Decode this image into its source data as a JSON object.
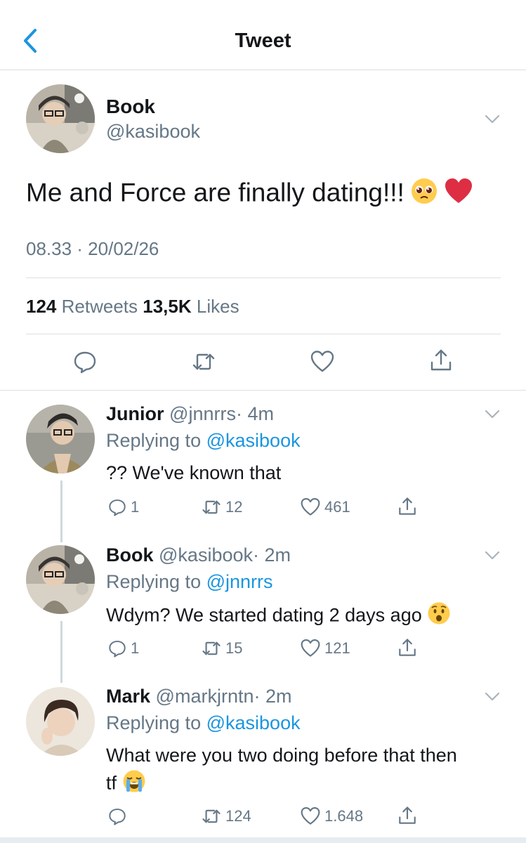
{
  "header": {
    "title": "Tweet"
  },
  "main_tweet": {
    "name": "Book",
    "handle": "@kasibook",
    "text": "Me and Force are finally dating!!!",
    "timestamp": "08.33 · 20/02/26",
    "retweets_count": "124",
    "retweets_label": "Retweets",
    "likes_count": "13,5K",
    "likes_label": "Likes"
  },
  "replies": [
    {
      "name": "Junior",
      "handle": "@jnnrrs",
      "time": "· 4m",
      "replying_label": "Replying to",
      "replying_to": "@kasibook",
      "text": "?? We've known that",
      "reply_count": "1",
      "retweet_count": "12",
      "like_count": "461"
    },
    {
      "name": "Book",
      "handle": "@kasibook",
      "time": "· 2m",
      "replying_label": "Replying to",
      "replying_to": "@jnnrrs",
      "text": "Wdym? We started dating 2 days ago",
      "reply_count": "1",
      "retweet_count": "15",
      "like_count": "121"
    },
    {
      "name": "Mark",
      "handle": "@markjrntn",
      "time": "· 2m",
      "replying_label": "Replying to",
      "replying_to": "@kasibook",
      "text_line1": "What were you two doing before that then",
      "text_line2": "tf",
      "reply_count": "",
      "retweet_count": "124",
      "like_count": "1.648"
    }
  ],
  "colors": {
    "accent": "#1b95e0",
    "muted": "#657786",
    "text": "#14171a",
    "divider": "#dcdfe2"
  }
}
